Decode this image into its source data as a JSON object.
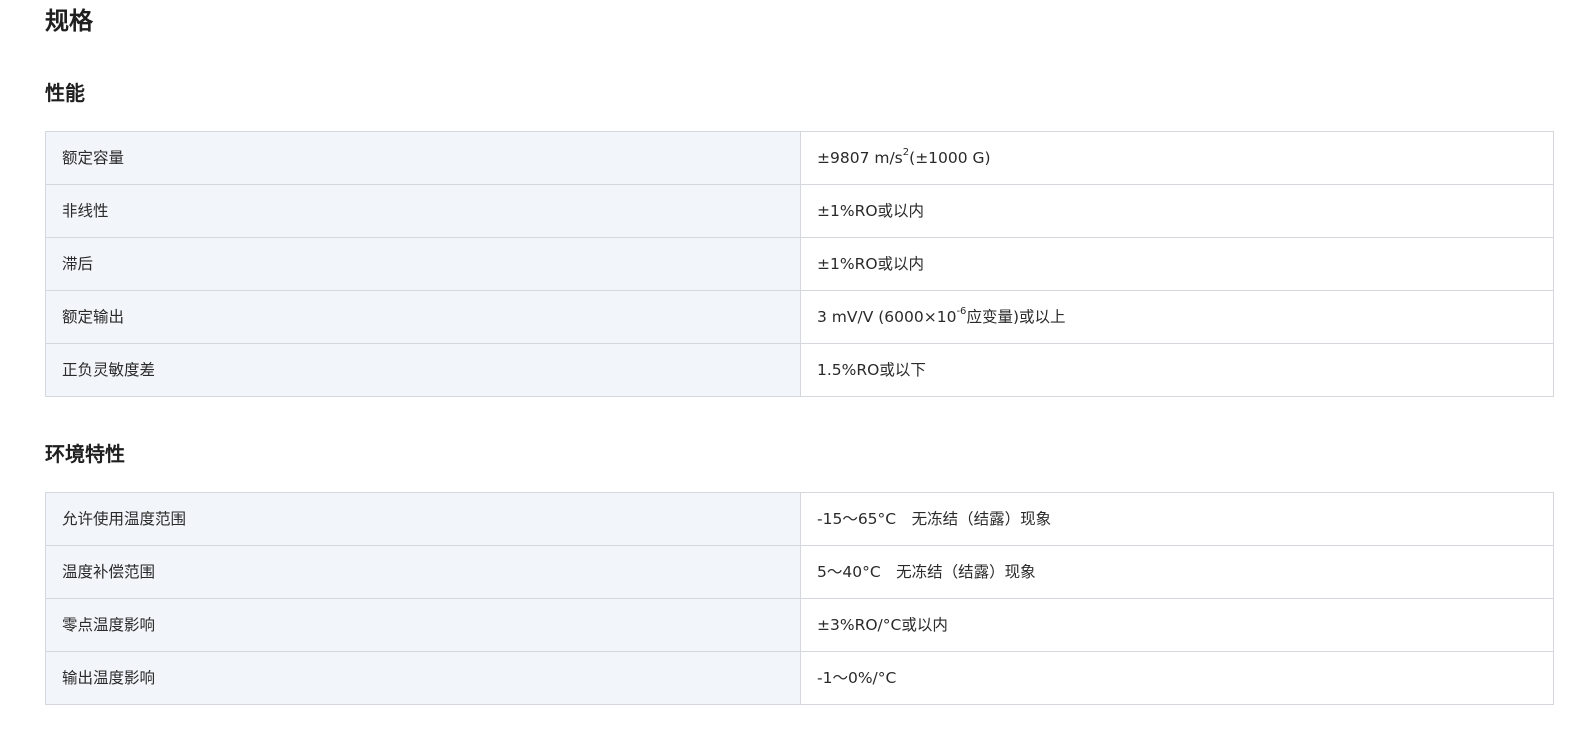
{
  "page_title": "规格",
  "performance": {
    "title": "性能",
    "rows": [
      {
        "label": "额定容量",
        "value_main": "±9807 m/s",
        "value_sup": "2",
        "value_tail": "(±1000 G)"
      },
      {
        "label": "非线性",
        "value_main": "±1%RO或以内",
        "value_sup": "",
        "value_tail": ""
      },
      {
        "label": "滞后",
        "value_main": "±1%RO或以内",
        "value_sup": "",
        "value_tail": ""
      },
      {
        "label": "额定输出",
        "value_main": "3 mV/V (6000×10",
        "value_sup": "-6",
        "value_tail": "应变量)或以上"
      },
      {
        "label": "正负灵敏度差",
        "value_main": "1.5%RO或以下",
        "value_sup": "",
        "value_tail": ""
      }
    ]
  },
  "environment": {
    "title": "环境特性",
    "rows": [
      {
        "label": "允许使用温度范围",
        "value": "-15～65°C　无冻结（结露）现象"
      },
      {
        "label": "温度补偿范围",
        "value": "5～40°C　无冻结（结露）现象"
      },
      {
        "label": "零点温度影响",
        "value": "±3%RO/°C或以内"
      },
      {
        "label": "输出温度影响",
        "value": "-1～0%/°C"
      }
    ]
  }
}
